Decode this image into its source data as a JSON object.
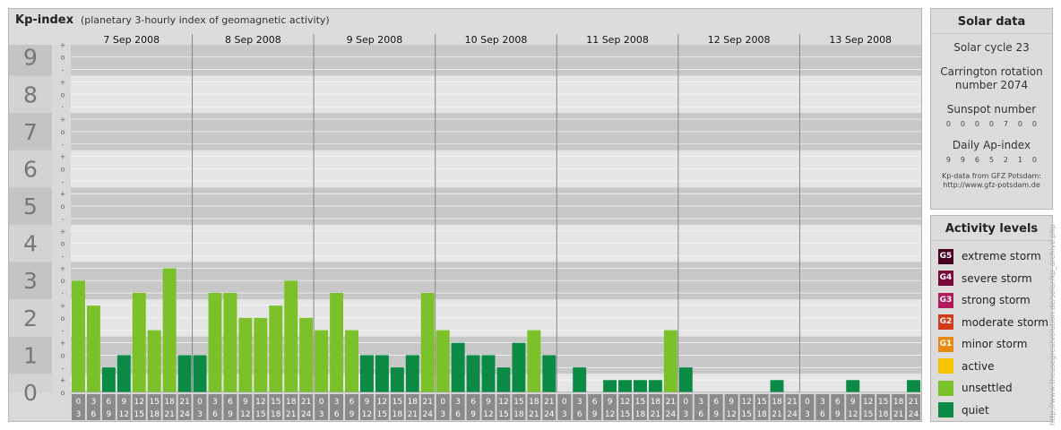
{
  "header": {
    "title": "Kp-index",
    "subtitle": "(planetary 3-hourly index of geomagnetic activity)"
  },
  "chart_data": {
    "type": "bar",
    "y_labels": [
      "0",
      "1",
      "2",
      "3",
      "4",
      "5",
      "6",
      "7",
      "8",
      "9"
    ],
    "minor_labels": [
      "o",
      "+",
      "-"
    ],
    "hours_top": [
      "0",
      "3",
      "6",
      "9",
      "12",
      "15",
      "18",
      "21"
    ],
    "hours_bottom": [
      "3",
      "6",
      "9",
      "12",
      "15",
      "18",
      "21",
      "24"
    ],
    "ylim": [
      0,
      9.33
    ],
    "days": [
      {
        "date": "7 Sep 2008",
        "kp": [
          3.0,
          2.33,
          0.67,
          1.0,
          2.67,
          1.67,
          3.33,
          1.0
        ]
      },
      {
        "date": "8 Sep 2008",
        "kp": [
          1.0,
          2.67,
          2.67,
          2.0,
          2.0,
          2.33,
          3.0,
          2.0
        ]
      },
      {
        "date": "9 Sep 2008",
        "kp": [
          1.67,
          2.67,
          1.67,
          1.0,
          1.0,
          0.67,
          1.0,
          2.67
        ]
      },
      {
        "date": "10 Sep 2008",
        "kp": [
          1.67,
          1.33,
          1.0,
          1.0,
          0.67,
          1.33,
          1.67,
          1.0
        ]
      },
      {
        "date": "11 Sep 2008",
        "kp": [
          0.0,
          0.67,
          0.0,
          0.33,
          0.33,
          0.33,
          0.33,
          1.67
        ]
      },
      {
        "date": "12 Sep 2008",
        "kp": [
          0.67,
          0.0,
          0.0,
          0.0,
          0.0,
          0.0,
          0.33,
          0.0
        ]
      },
      {
        "date": "13 Sep 2008",
        "kp": [
          0.0,
          0.0,
          0.0,
          0.33,
          0.0,
          0.0,
          0.0,
          0.33
        ]
      }
    ],
    "colors": {
      "quiet": "#0b8a45",
      "unsettled": "#7bc12a"
    }
  },
  "solar": {
    "title": "Solar data",
    "cycle": "Solar cycle 23",
    "carrington_line1": "Carrington rotation",
    "carrington_line2": "number 2074",
    "sunspot_label": "Sunspot number",
    "sunspot_values": [
      "0",
      "0",
      "0",
      "0",
      "7",
      "0",
      "0"
    ],
    "ap_label": "Daily Ap-index",
    "ap_values": [
      "9",
      "9",
      "6",
      "5",
      "2",
      "1",
      "0"
    ],
    "source_line1": "Kp-data from GFZ Potsdam:",
    "source_line2": "http://www.gfz-potsdam.de"
  },
  "levels": {
    "title": "Activity levels",
    "items": [
      {
        "badge": "G5",
        "label": "extreme storm",
        "color": "#4a0022"
      },
      {
        "badge": "G4",
        "label": "severe storm",
        "color": "#7a0a3c"
      },
      {
        "badge": "G3",
        "label": "strong storm",
        "color": "#b01a5a"
      },
      {
        "badge": "G2",
        "label": "moderate storm",
        "color": "#d23a1a"
      },
      {
        "badge": "G1",
        "label": "minor storm",
        "color": "#e88a12"
      },
      {
        "badge": "",
        "label": "active",
        "color": "#f7c400"
      },
      {
        "badge": "",
        "label": "unsettled",
        "color": "#7bc12a"
      },
      {
        "badge": "",
        "label": "quiet",
        "color": "#0b8a45"
      }
    ]
  },
  "credit": "http://www.theusegreatvolution.de/solar/kp_archive.php"
}
